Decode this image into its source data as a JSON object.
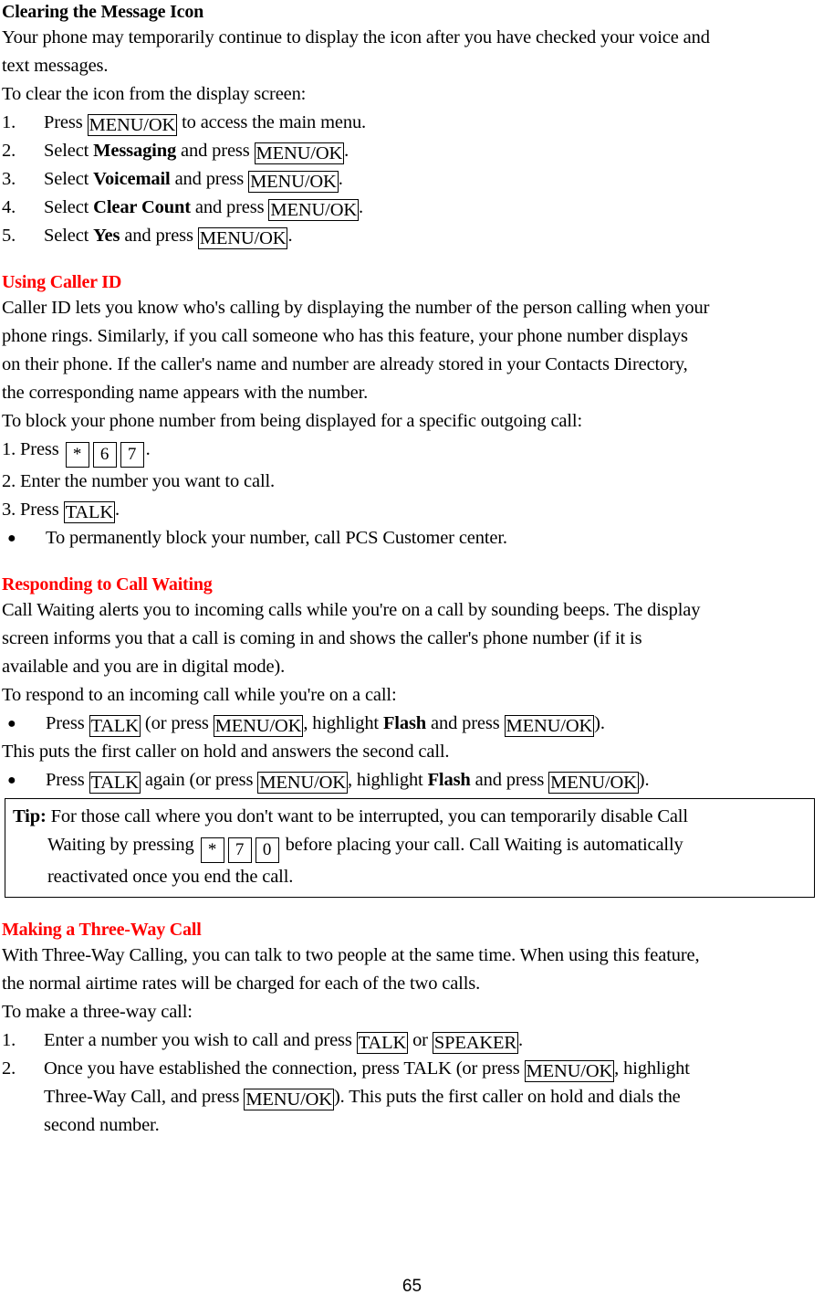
{
  "document": {
    "page_number": "65"
  },
  "sections": [
    {
      "id": "clearing-message-icon",
      "heading": "Clearing the Message Icon",
      "heading_color": "#000000",
      "intro_lines": [
        "Your phone may temporarily continue to display the icon after you have checked your voice and",
        "text messages.",
        "To clear the icon from the display screen:"
      ],
      "steps": [
        {
          "number": "1.",
          "pre": "Press ",
          "key": "MENU/OK",
          "post": " to access the main menu."
        },
        {
          "number": "2.",
          "pre": "Select ",
          "bold": "Messaging",
          "mid": " and press ",
          "key": "MENU/OK",
          "post": "."
        },
        {
          "number": "3.",
          "pre": "Select ",
          "bold": "Voicemail",
          "mid": " and press ",
          "key": "MENU/OK",
          "post": "."
        },
        {
          "number": "4.",
          "pre": "Select ",
          "bold": "Clear Count",
          "mid": " and press ",
          "key": "MENU/OK",
          "post": "."
        },
        {
          "number": "5.",
          "pre": "Select ",
          "bold": "Yes",
          "mid": " and press ",
          "key": "MENU/OK",
          "post": "."
        }
      ]
    },
    {
      "id": "using-caller-id",
      "heading": "Using Caller ID",
      "heading_color": "#FF0000",
      "body_lines": [
        "Caller ID lets you know who's calling by displaying the number of the person calling when your",
        "phone rings. Similarly, if you call someone who has this feature, your phone number displays",
        "on their phone. If the caller's name and number are already stored in your Contacts Directory,",
        "the corresponding name appears with the number.",
        "To block your phone number from being displayed for a specific outgoing call:"
      ],
      "step1_prefix": "1. Press",
      "step1_keys": [
        "*",
        "6",
        "7"
      ],
      "step1_suffix": ".",
      "step2": "2. Enter the number you want to call.",
      "step3_prefix": "3. Press ",
      "step3_key": "TALK",
      "step3_suffix": ".",
      "bullet": "To permanently block your number, call PCS Customer center."
    },
    {
      "id": "responding-call-waiting",
      "heading": "Responding to Call Waiting",
      "heading_color": "#FF0000",
      "body_lines": [
        "Call Waiting alerts you to incoming calls while you're on a call by sounding beeps. The display",
        "screen informs you that a call is coming in and shows the caller's phone number (if it is",
        "available and you are in digital mode).",
        "To respond to an incoming call while you're on a call:"
      ],
      "bullet1": {
        "p1": "Press ",
        "k1": "TALK",
        "p2": " (or press ",
        "k2": "MENU/OK",
        "p3": ", highlight ",
        "b1": "Flash",
        "p4": " and press ",
        "k3": "MENU/OK",
        "p5": ")."
      },
      "middle_line": "This puts the first caller on hold and answers the second call.",
      "bullet2": {
        "p1": "Press ",
        "k1": "TALK",
        "p2": " again (or press ",
        "k2": "MENU/OK",
        "p3": ", highlight ",
        "b1": "Flash",
        "p4": " and press ",
        "k3": "MENU/OK",
        "p5": ")."
      },
      "tip": {
        "label": "Tip:",
        "line1": " For those call where you don't want to be interrupted, you can temporarily disable Call",
        "line2_pre": "Waiting by pressing",
        "line2_keys": [
          "*",
          "7",
          "0"
        ],
        "line2_post": " before placing your call. Call Waiting is automatically",
        "line3": "reactivated once you end the call."
      }
    },
    {
      "id": "making-three-way-call",
      "heading": "Making a Three-Way Call",
      "heading_color": "#FF0000",
      "body_lines": [
        "With Three-Way Calling, you can talk to two people at the same time. When using this feature,",
        "the normal airtime rates will be charged for each of the two calls.",
        "To make a three-way call:"
      ],
      "step1": {
        "number": "1.",
        "p1": "Enter a number you wish to call and press ",
        "k1": "TALK",
        "p2": " or ",
        "k2": "SPEAKER",
        "p3": "."
      },
      "step2": {
        "number": "2.",
        "p1": "Once you have established the connection, press TALK (or press ",
        "k1": "MENU/OK",
        "p2": ", highlight",
        "p3": "Three-Way Call, and press ",
        "k2": "MENU/OK",
        "p4": "). This puts the first caller on hold and dials the",
        "p5": "second number."
      }
    }
  ]
}
